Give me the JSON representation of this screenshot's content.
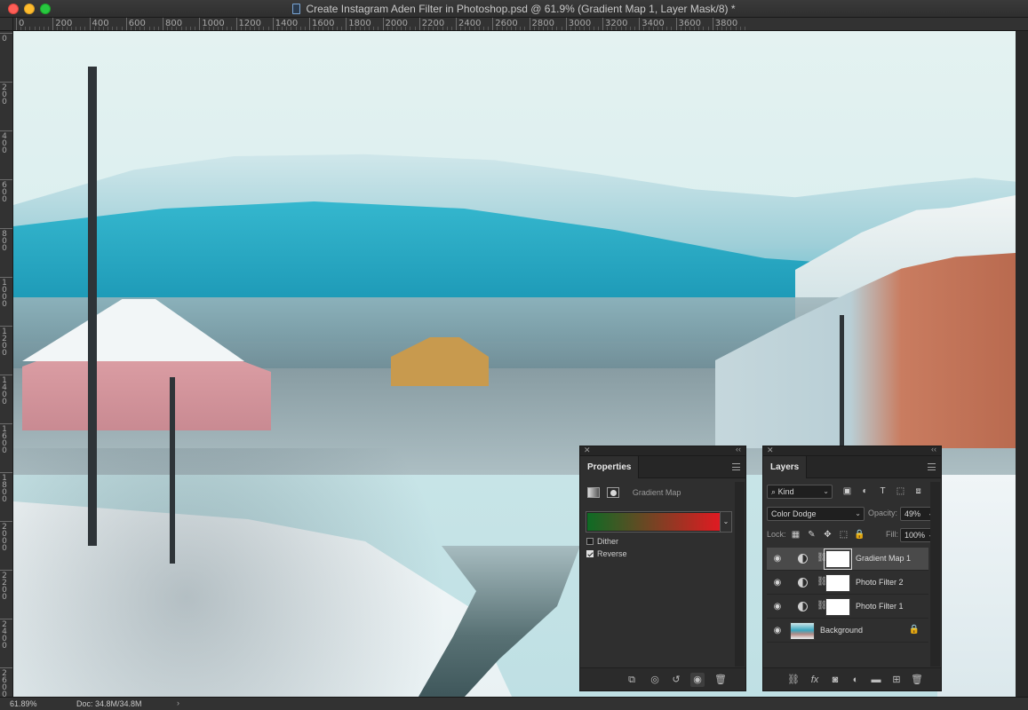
{
  "window": {
    "title": "Create Instagram Aden Filter in Photoshop.psd @ 61.9% (Gradient Map 1, Layer Mask/8) *"
  },
  "rulers": {
    "top_labels": [
      "0",
      "200",
      "400",
      "600",
      "800",
      "1000",
      "1200",
      "1400",
      "1600",
      "1800",
      "2000",
      "2200",
      "2400",
      "2600",
      "2800",
      "3000",
      "3200",
      "3400",
      "3600",
      "3800"
    ],
    "left_labels": [
      "0",
      "200",
      "400",
      "600",
      "800",
      "1000",
      "1200",
      "1400",
      "1600",
      "1800",
      "2000",
      "2200",
      "2400",
      "2600"
    ]
  },
  "properties": {
    "tab": "Properties",
    "title": "Gradient Map",
    "gradient_colors": [
      "#0e6b24",
      "#e01a22"
    ],
    "dither_label": "Dither",
    "dither_checked": false,
    "reverse_label": "Reverse",
    "reverse_checked": true
  },
  "layers_panel": {
    "tab": "Layers",
    "filter_kind": "Kind",
    "blend_mode": "Color Dodge",
    "opacity_label": "Opacity:",
    "opacity_value": "49%",
    "lock_label": "Lock:",
    "fill_label": "Fill:",
    "fill_value": "100%",
    "layers": [
      {
        "name": "Gradient Map 1",
        "selected": true
      },
      {
        "name": "Photo Filter 2",
        "selected": false
      },
      {
        "name": "Photo Filter 1",
        "selected": false
      }
    ],
    "background_layer": "Background"
  },
  "status": {
    "zoom": "61.89%",
    "doc": "Doc: 34.8M/34.8M"
  }
}
